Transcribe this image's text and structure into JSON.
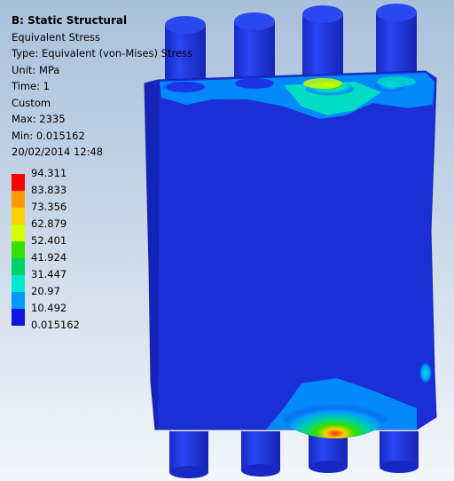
{
  "analysis": {
    "title": "B: Static Structural",
    "result": "Equivalent Stress",
    "type": "Type: Equivalent (von-Mises) Stress",
    "unit": "Unit: MPa",
    "time": "Time: 1",
    "mode": "Custom",
    "max": "Max: 2335",
    "min": "Min: 0.015162",
    "timestamp": "20/02/2014 12:48"
  },
  "legend": {
    "labels": [
      "94.311",
      "83.833",
      "73.356",
      "62.879",
      "52.401",
      "41.924",
      "31.447",
      "20.97",
      "10.492",
      "0.015162"
    ],
    "colors": [
      "#ff0000",
      "#ff9900",
      "#ffd000",
      "#d4ff00",
      "#33e000",
      "#00d26a",
      "#00e6d0",
      "#0099ff",
      "#1111e0"
    ]
  },
  "colors": {
    "body": "#1a2fd6",
    "body_side": "#1424b8",
    "cylinder": "#1f38e8",
    "cylinder_top": "#2a48f0"
  }
}
